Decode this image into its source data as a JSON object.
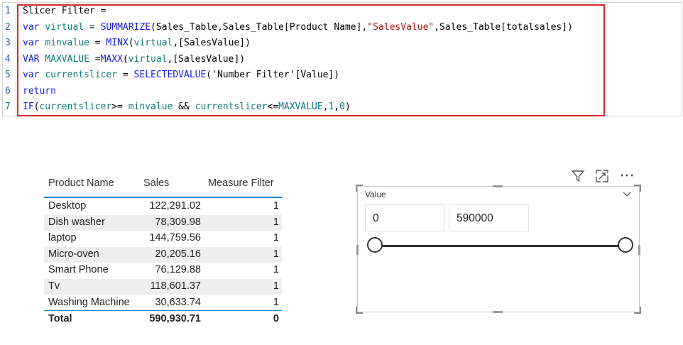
{
  "editor": {
    "line_numbers": [
      "1",
      "2",
      "3",
      "4",
      "5",
      "6",
      "7"
    ],
    "lines": [
      [
        {
          "t": "Slicer Filter =",
          "c": "plain"
        }
      ],
      [
        {
          "t": "var",
          "c": "kw"
        },
        {
          "t": " ",
          "c": "plain"
        },
        {
          "t": "virtual",
          "c": "var"
        },
        {
          "t": " = ",
          "c": "plain"
        },
        {
          "t": "SUMMARIZE",
          "c": "fn"
        },
        {
          "t": "(Sales_Table,Sales_Table[Product Name],",
          "c": "plain"
        },
        {
          "t": "\"SalesValue\"",
          "c": "str"
        },
        {
          "t": ",Sales_Table[totalsales])",
          "c": "plain"
        }
      ],
      [
        {
          "t": "var",
          "c": "kw"
        },
        {
          "t": " ",
          "c": "plain"
        },
        {
          "t": "minvalue",
          "c": "var"
        },
        {
          "t": " = ",
          "c": "plain"
        },
        {
          "t": "MINX",
          "c": "fn"
        },
        {
          "t": "(",
          "c": "plain"
        },
        {
          "t": "virtual",
          "c": "var"
        },
        {
          "t": ",[SalesValue])",
          "c": "plain"
        }
      ],
      [
        {
          "t": "VAR",
          "c": "kw"
        },
        {
          "t": " ",
          "c": "plain"
        },
        {
          "t": "MAXVALUE",
          "c": "var"
        },
        {
          "t": " =",
          "c": "plain"
        },
        {
          "t": "MAXX",
          "c": "fn"
        },
        {
          "t": "(",
          "c": "plain"
        },
        {
          "t": "virtual",
          "c": "var"
        },
        {
          "t": ",[SalesValue])",
          "c": "plain"
        }
      ],
      [
        {
          "t": "var",
          "c": "kw"
        },
        {
          "t": " ",
          "c": "plain"
        },
        {
          "t": "currentslicer",
          "c": "var"
        },
        {
          "t": " = ",
          "c": "plain"
        },
        {
          "t": "SELECTEDVALUE",
          "c": "fn"
        },
        {
          "t": "('Number Filter'[Value])",
          "c": "plain"
        }
      ],
      [
        {
          "t": "return",
          "c": "kw"
        }
      ],
      [
        {
          "t": "IF",
          "c": "fn"
        },
        {
          "t": "(",
          "c": "plain"
        },
        {
          "t": "currentslicer",
          "c": "var"
        },
        {
          "t": ">= ",
          "c": "plain"
        },
        {
          "t": "minvalue",
          "c": "var"
        },
        {
          "t": " && ",
          "c": "plain"
        },
        {
          "t": "currentslicer",
          "c": "var"
        },
        {
          "t": "<=",
          "c": "plain"
        },
        {
          "t": "MAXVALUE",
          "c": "var"
        },
        {
          "t": ",",
          "c": "plain"
        },
        {
          "t": "1",
          "c": "num"
        },
        {
          "t": ",",
          "c": "plain"
        },
        {
          "t": "0",
          "c": "num"
        },
        {
          "t": ")",
          "c": "plain"
        }
      ]
    ]
  },
  "table": {
    "headers": [
      "Product Name",
      "Sales",
      "Measure Filter"
    ],
    "rows": [
      [
        "Desktop",
        "122,291.02",
        "1"
      ],
      [
        "Dish washer",
        "78,309.98",
        "1"
      ],
      [
        "laptop",
        "144,759.56",
        "1"
      ],
      [
        "Micro-oven",
        "20,205.16",
        "1"
      ],
      [
        "Smart Phone",
        "76,129.88",
        "1"
      ],
      [
        "Tv",
        "118,601.37",
        "1"
      ],
      [
        "Washing Machine",
        "30,633.74",
        "1"
      ]
    ],
    "total": [
      "Total",
      "590,930.71",
      "0"
    ]
  },
  "slicer": {
    "title": "Value",
    "min_value": "0",
    "max_value": "590000",
    "icons": [
      "filter-icon",
      "focus-mode-icon",
      "more-options-icon",
      "chevron-down-icon"
    ]
  },
  "colors": {
    "highlight_border": "#d22a2a",
    "keyword": "#1b1be0",
    "variable": "#0c7a7a",
    "string": "#a31515",
    "table_accent": "#0e86d4"
  }
}
